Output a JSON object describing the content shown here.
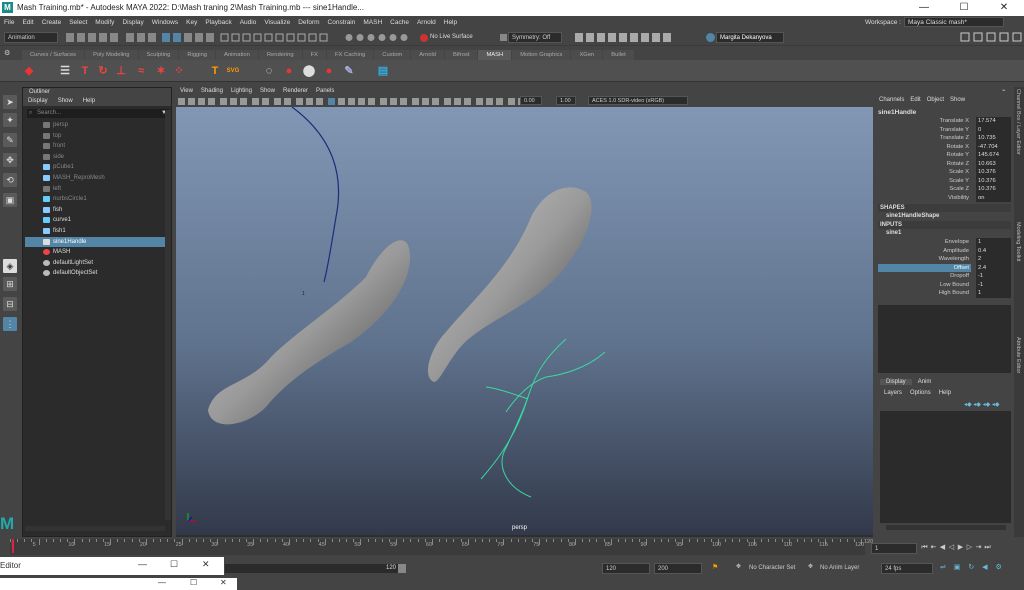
{
  "title": {
    "text": "Mash Training.mb* - Autodesk MAYA 2022: D:\\Mash  traning 2\\Mash Training.mb    ---    sine1Handle...",
    "logo": "M"
  },
  "menus": [
    "File",
    "Edit",
    "Create",
    "Select",
    "Modify",
    "Display",
    "Windows",
    "Key",
    "Playback",
    "Audio",
    "Visualize",
    "Deform",
    "Constrain",
    "MASH",
    "Cache",
    "Arnold",
    "Help"
  ],
  "workspace": {
    "label": "Workspace :",
    "value": "Maya Classic mash*"
  },
  "statusline": {
    "mode": "Animation",
    "surface": "No Live Surface",
    "symmetry": "Symmetry: Off",
    "user": "Margita Dekanyova"
  },
  "shelf_tabs": [
    "Curves / Surfaces",
    "Poly Modeling",
    "Sculpting",
    "Rigging",
    "Animation",
    "Rendering",
    "FX",
    "FX Caching",
    "Custom",
    "Arnold",
    "Bifrost",
    "MASH",
    "Motion Graphics",
    "XGen",
    "Bullet"
  ],
  "shelf_active": "MASH",
  "outliner": {
    "title": "Outliner",
    "menu": [
      "Display",
      "Show",
      "Help"
    ],
    "search": "Search...",
    "items": [
      {
        "label": "persp",
        "icon": "camera-icon",
        "dim": true
      },
      {
        "label": "top",
        "icon": "camera-icon",
        "dim": true
      },
      {
        "label": "front",
        "icon": "camera-icon",
        "dim": true
      },
      {
        "label": "side",
        "icon": "camera-icon",
        "dim": true
      },
      {
        "label": "pCube1",
        "icon": "mesh-icon",
        "dim": true
      },
      {
        "label": "MASH_ReproMesh",
        "icon": "mesh-icon",
        "dim": true
      },
      {
        "label": "left",
        "icon": "camera-icon",
        "dim": true
      },
      {
        "label": "nurbsCircle1",
        "icon": "curve-icon",
        "dim": true
      },
      {
        "label": "fish",
        "icon": "mesh-icon",
        "dim": false
      },
      {
        "label": "curve1",
        "icon": "curve-icon",
        "dim": false
      },
      {
        "label": "fish1",
        "icon": "mesh-icon",
        "dim": false
      },
      {
        "label": "sine1Handle",
        "icon": "deformer-icon",
        "dim": false,
        "selected": true
      },
      {
        "label": "MASH",
        "icon": "mash-icon",
        "dim": false
      },
      {
        "label": "defaultLightSet",
        "icon": "set-icon",
        "dim": false
      },
      {
        "label": "defaultObjectSet",
        "icon": "set-icon",
        "dim": false
      }
    ]
  },
  "viewport": {
    "menu": [
      "View",
      "Shading",
      "Lighting",
      "Show",
      "Renderer",
      "Panels"
    ],
    "near": "0.00",
    "far": "1.00",
    "colorspace": "ACES 1.0 SDR-video (sRGB)",
    "camera": "persp",
    "marker": "1"
  },
  "channelbox": {
    "tabs": [
      "Channels",
      "Edit",
      "Object",
      "Show"
    ],
    "node": "sine1Handle",
    "channels": [
      {
        "name": "Translate X",
        "value": "17.574"
      },
      {
        "name": "Translate Y",
        "value": "0"
      },
      {
        "name": "Translate Z",
        "value": "10.735"
      },
      {
        "name": "Rotate X",
        "value": "-47.704"
      },
      {
        "name": "Rotate Y",
        "value": "145.674"
      },
      {
        "name": "Rotate Z",
        "value": "10.663"
      },
      {
        "name": "Scale X",
        "value": "10.376"
      },
      {
        "name": "Scale Y",
        "value": "10.376"
      },
      {
        "name": "Scale Z",
        "value": "10.376"
      },
      {
        "name": "Visibility",
        "value": "on"
      }
    ],
    "shapes_label": "SHAPES",
    "shape": "sine1HandleShape",
    "inputs_label": "INPUTS",
    "input": "sine1",
    "inputs": [
      {
        "name": "Envelope",
        "value": "1"
      },
      {
        "name": "Amplitude",
        "value": "0.4"
      },
      {
        "name": "Wavelength",
        "value": "2"
      },
      {
        "name": "Offset",
        "value": "2.4",
        "highlight": true
      },
      {
        "name": "Dropoff",
        "value": "-1"
      },
      {
        "name": "Low Bound",
        "value": "-1"
      },
      {
        "name": "High Bound",
        "value": "1"
      }
    ]
  },
  "layer_editor": {
    "tabs": [
      "Display",
      "Anim"
    ],
    "menu": [
      "Layers",
      "Options",
      "Help"
    ]
  },
  "side_tabs": [
    "Channel Box / Layer Editor",
    "Modeling Toolkit",
    "Attribute Editor"
  ],
  "timeline": {
    "ticks": [
      "5",
      "10",
      "15",
      "20",
      "25",
      "30",
      "35",
      "40",
      "45",
      "50",
      "55",
      "60",
      "65",
      "70",
      "75",
      "80",
      "85",
      "90",
      "95",
      "100",
      "105",
      "110",
      "115",
      "120"
    ],
    "start_label": "1",
    "current": "1"
  },
  "range": {
    "start_end": "120",
    "end": "120",
    "max": "200",
    "character": "No Character Set",
    "anim_layer": "No Anim Layer",
    "fps": "24 fps"
  },
  "floating": {
    "editor_label": "Editor"
  }
}
